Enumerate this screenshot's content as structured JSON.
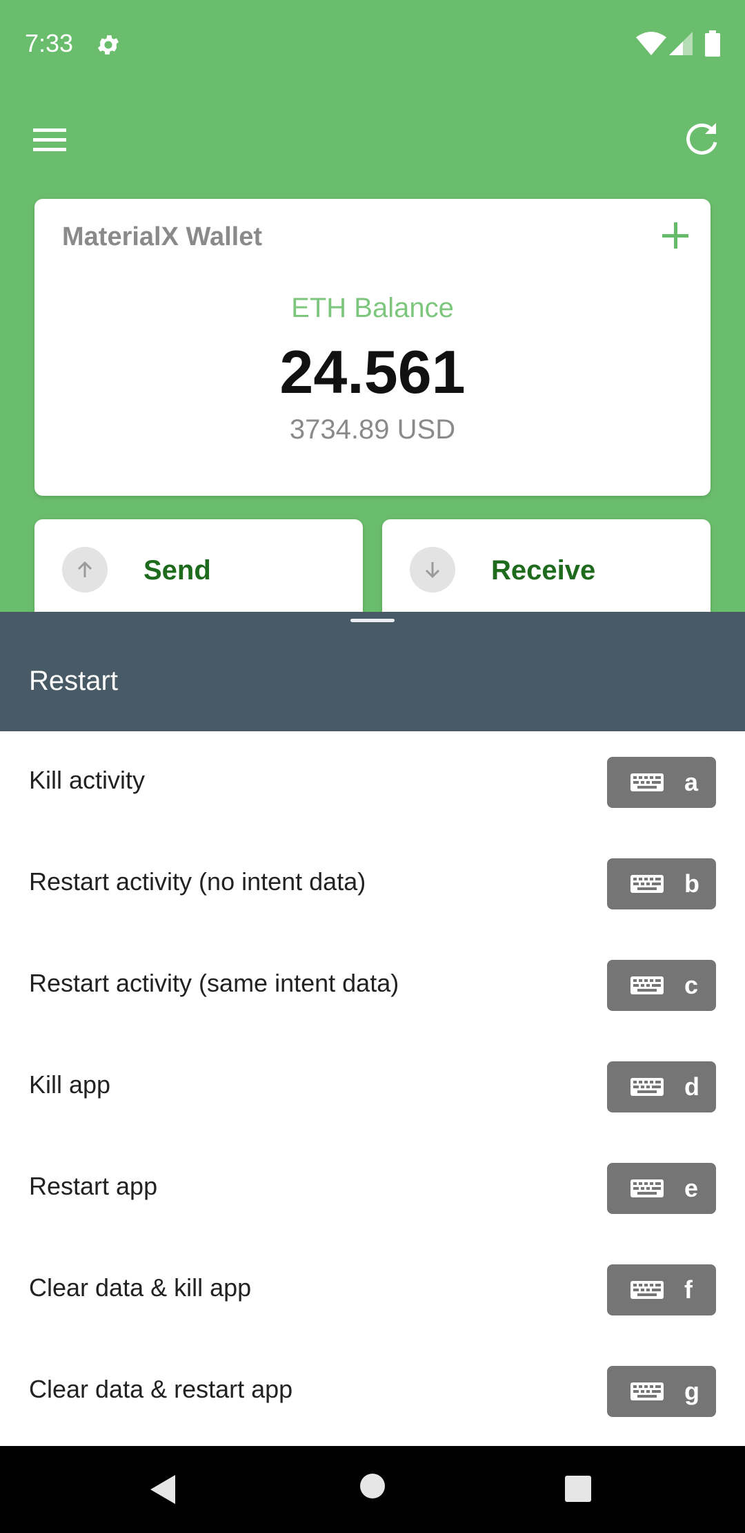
{
  "status_bar": {
    "time": "7:33"
  },
  "wallet": {
    "name": "MaterialX Wallet",
    "balance_label": "ETH Balance",
    "balance": "24.561",
    "balance_usd": "3734.89 USD"
  },
  "actions": {
    "send_label": "Send",
    "receive_label": "Receive"
  },
  "sheet": {
    "title": "Restart",
    "items": [
      {
        "label": "Kill activity",
        "key": "a"
      },
      {
        "label": "Restart activity (no intent data)",
        "key": "b"
      },
      {
        "label": "Restart activity (same intent data)",
        "key": "c"
      },
      {
        "label": "Kill app",
        "key": "d"
      },
      {
        "label": "Restart app",
        "key": "e"
      },
      {
        "label": "Clear data & kill app",
        "key": "f"
      },
      {
        "label": "Clear data & restart app",
        "key": "g"
      }
    ]
  },
  "icons": {
    "gear": "gear-icon",
    "wifi": "wifi-icon",
    "signal": "signal-icon",
    "battery": "battery-icon",
    "menu": "menu-icon",
    "refresh": "refresh-icon",
    "add": "plus-icon",
    "send": "arrow-up-icon",
    "receive": "arrow-down-icon",
    "keyboard": "keyboard-icon"
  },
  "colors": {
    "primary": "#6abd6c",
    "accent_text": "#1e6b1e",
    "sheet_header": "#485a66",
    "badge": "#757575"
  }
}
